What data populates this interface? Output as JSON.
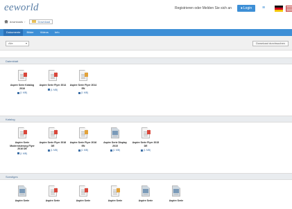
{
  "header": {
    "logo": "eeworld",
    "signin_text": "Registrieren oder Melden Sie sich an",
    "login_label": "Login",
    "help_icon": "help-icon"
  },
  "breadcrumb": {
    "home": "downloads",
    "current": "Download"
  },
  "tabs": [
    {
      "label": "Dokumente",
      "active": true
    },
    {
      "label": "Bilder"
    },
    {
      "label": "Videos"
    },
    {
      "label": "Info"
    }
  ],
  "toolbar": {
    "filter_value": "Alle",
    "search_button": "Download durchsuchen"
  },
  "sections": [
    {
      "title": "Datenblatt",
      "items": [
        {
          "name": "Aspire Serie Katalog 2016",
          "meta": "(1 MB)",
          "type": "doc"
        },
        {
          "name": "Aspire Serie Flyer 2014",
          "meta": "(1 MB)",
          "type": "doc"
        },
        {
          "name": "Aspire Serie Flyer 2014 EN",
          "meta": "(1 MB)",
          "type": "xls"
        }
      ]
    },
    {
      "title": "Katalog",
      "items": [
        {
          "name": "Aspire Serie Modernisierung Flyer 2016 DE",
          "meta": "(1 MB)",
          "type": "doc"
        },
        {
          "name": "Aspire Serie Flyer 2016 DE",
          "meta": "(1 MB)",
          "type": "doc"
        },
        {
          "name": "Aspire Serie Flyer 2016 EN",
          "meta": "(1 MB)",
          "type": "xls"
        },
        {
          "name": "Aspire Serie Display 2015",
          "meta": "(1 MB)",
          "type": "img"
        },
        {
          "name": "Aspire Serie Flyer 2015 DE",
          "meta": "(1 MB)",
          "type": "doc"
        }
      ]
    },
    {
      "title": "Sonstiges",
      "items": [
        {
          "name": "Aspire Serie",
          "type": "img"
        },
        {
          "name": "Aspire Serie",
          "type": "doc"
        },
        {
          "name": "Aspire Serie",
          "type": "doc"
        },
        {
          "name": "Aspire Serie",
          "type": "xls"
        },
        {
          "name": "Aspire Serie",
          "type": "img"
        },
        {
          "name": "Aspire Serie",
          "type": "img"
        }
      ]
    }
  ]
}
